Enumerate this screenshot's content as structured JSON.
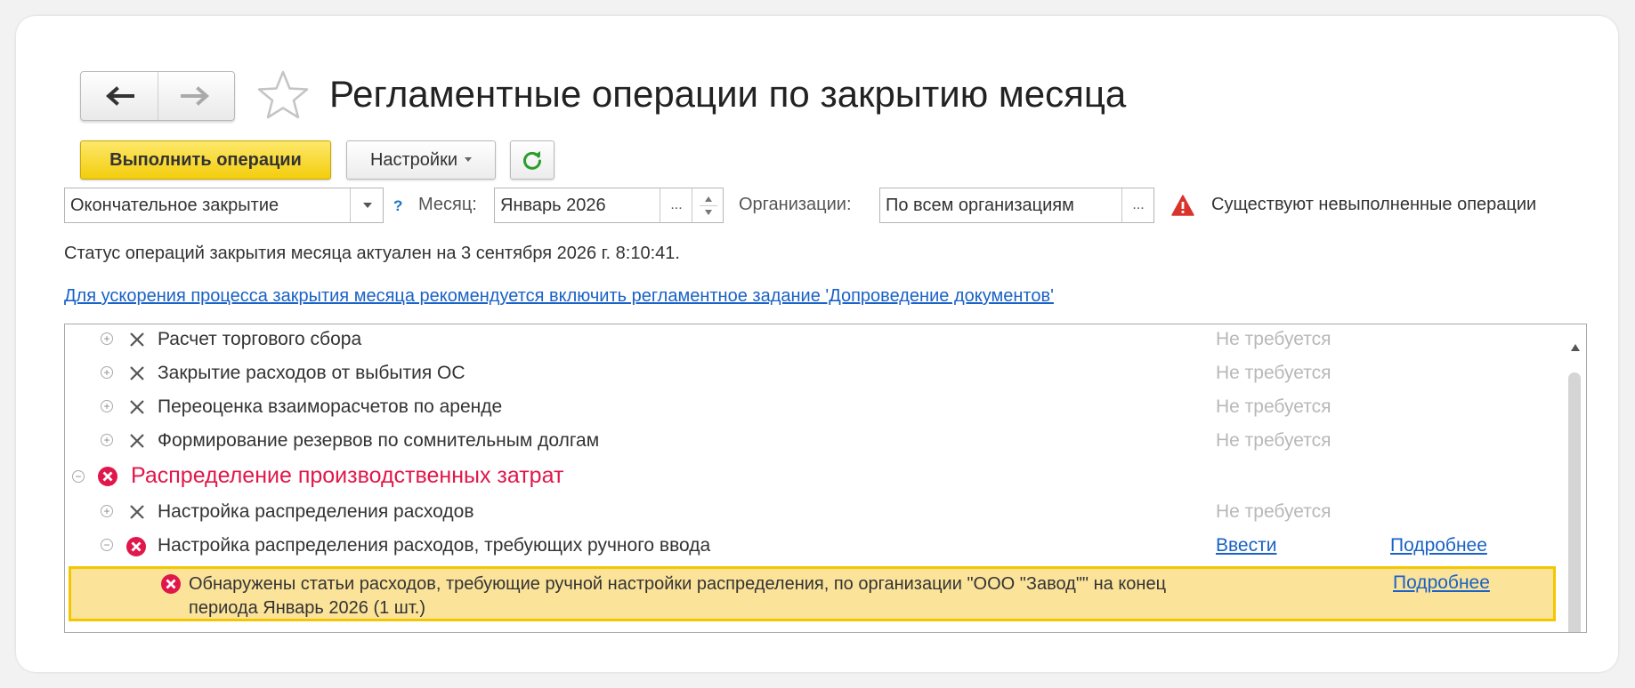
{
  "header": {
    "title": "Регламентные операции по закрытию месяца"
  },
  "toolbar": {
    "execute_label": "Выполнить операции",
    "settings_label": "Настройки"
  },
  "filters": {
    "mode_value": "Окончательное закрытие",
    "help_mark": "?",
    "month_label": "Месяц:",
    "month_value": "Январь 2026",
    "org_label": "Организации:",
    "org_value": "По всем организациям",
    "ellipsis": "...",
    "warning": "Существуют невыполненные операции"
  },
  "status": {
    "text": "Статус операций закрытия месяца актуален на 3 сентября 2026 г. 8:10:41.",
    "hint_link": "Для ускорения процесса закрытия месяца рекомендуется включить регламентное задание 'Допроведение документов'"
  },
  "operations": [
    {
      "name": "Расчет торгового сбора",
      "state": "Не требуется"
    },
    {
      "name": "Закрытие расходов от выбытия ОС",
      "state": "Не требуется"
    },
    {
      "name": "Переоценка взаиморасчетов по аренде",
      "state": "Не требуется"
    },
    {
      "name": "Формирование резервов по сомнительным долгам",
      "state": "Не требуется"
    }
  ],
  "group": {
    "title": "Распределение производственных затрат",
    "items": [
      {
        "name": "Настройка распределения расходов",
        "state": "Не требуется"
      },
      {
        "name": "Настройка распределения расходов, требующих ручного ввода",
        "action": "Ввести",
        "details": "Подробнее"
      }
    ],
    "error_message": {
      "text": "Обнаружены статьи расходов, требующие ручной настройки распределения, по организации \"ООО \"Завод\"\" на конец периода Январь 2026 (1 шт.)",
      "details": "Подробнее"
    }
  },
  "colors": {
    "primary_button": "#f3cd0c",
    "error": "#e0174a",
    "link": "#1a62c6",
    "muted": "#b8b8b8",
    "selection": "#fbe39a"
  },
  "icons": [
    "back-arrow-icon",
    "forward-arrow-icon",
    "star-icon",
    "refresh-icon",
    "warning-icon",
    "x-icon",
    "error-icon",
    "expand-icon",
    "collapse-icon"
  ]
}
